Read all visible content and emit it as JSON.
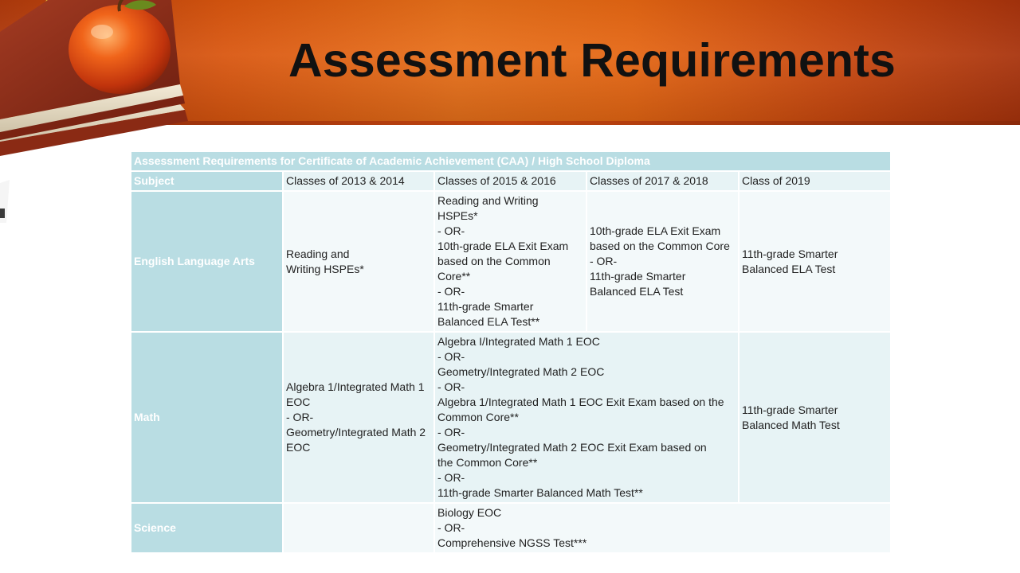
{
  "slide": {
    "title": "Assessment Requirements"
  },
  "table": {
    "caption": "Assessment Requirements for Certificate of Academic Achievement (CAA) / High School Diploma",
    "headers": [
      "Subject",
      "Classes of 2013 & 2014",
      "Classes of 2015 & 2016",
      "Classes of 2017 & 2018",
      "Class of 2019"
    ],
    "rows": {
      "ela": {
        "subject": "English Language Arts",
        "c2013": [
          "Reading and",
          "Writing HSPEs*"
        ],
        "c2015": [
          "Reading and Writing",
          "HSPEs*",
          "- OR-",
          "10th-grade ELA Exit Exam",
          "based on the Common",
          "Core**",
          "- OR-",
          "11th-grade Smarter",
          "Balanced ELA Test**"
        ],
        "c2017": [
          "10th-grade ELA Exit Exam",
          "based on the Common Core",
          "- OR-",
          "11th-grade Smarter",
          "Balanced ELA Test"
        ],
        "c2019": [
          "11th-grade Smarter",
          "Balanced ELA Test"
        ]
      },
      "math": {
        "subject": "Math",
        "c2013": [
          "Algebra 1/Integrated Math 1",
          "EOC",
          "- OR-",
          "Geometry/Integrated Math 2",
          "EOC"
        ],
        "c2015_2018": [
          "Algebra I/Integrated Math 1 EOC",
          "- OR-",
          "Geometry/Integrated Math 2 EOC",
          "- OR-",
          "Algebra 1/Integrated Math 1 EOC Exit Exam based on the",
          "Common Core**",
          "- OR-",
          "Geometry/Integrated Math 2 EOC Exit Exam based on",
          "the Common Core**",
          "- OR-",
          "11th-grade Smarter Balanced Math Test**"
        ],
        "c2019": [
          "11th-grade Smarter",
          "Balanced Math Test"
        ]
      },
      "science": {
        "subject": "Science",
        "c2013": [],
        "c2015_2019": [
          "Biology EOC",
          "- OR-",
          "Comprehensive NGSS Test***"
        ]
      }
    }
  },
  "colors": {
    "header_orange": "#e8701a",
    "table_header_blue": "#b9dde3",
    "cell_light": "#f3f9fa",
    "cell_dark": "#e7f3f5"
  }
}
